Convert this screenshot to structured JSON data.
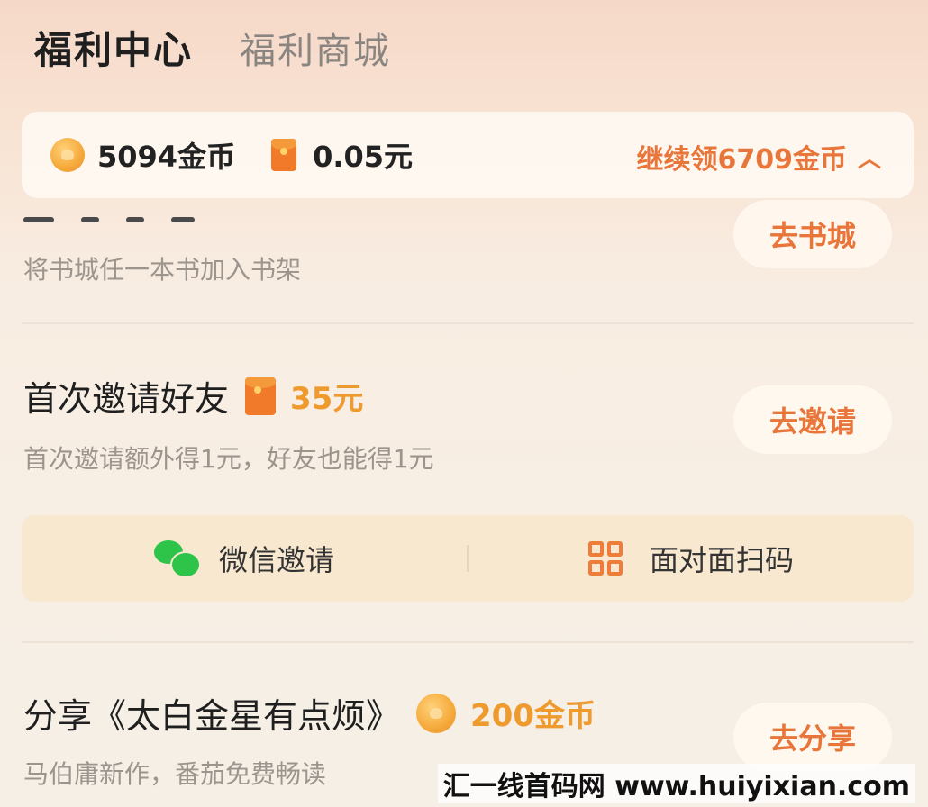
{
  "tabs": {
    "active": "福利中心",
    "other": "福利商城"
  },
  "wallet": {
    "coins": "5094金币",
    "cash": "0.05元",
    "more": "继续领6709金币",
    "more_icon": "chevron-up-icon"
  },
  "tasks": [
    {
      "title": "",
      "desc": "将书城任一本书加入书架",
      "button": "去书城"
    },
    {
      "title": "首次邀请好友",
      "reward": "35元",
      "reward_icon": "red-packet-icon",
      "desc": "首次邀请额外得1元，好友也能得1元",
      "button": "去邀请"
    },
    {
      "title": "分享《太白金星有点烦》",
      "reward": "200金币",
      "reward_icon": "coin-icon",
      "desc": "马伯庸新作，番茄免费畅读",
      "button": "去分享"
    }
  ],
  "invite_options": [
    {
      "label": "微信邀请",
      "icon": "wechat-icon"
    },
    {
      "label": "面对面扫码",
      "icon": "qr-code-icon"
    }
  ],
  "watermark": "汇一线首码网 www.huiyixian.com",
  "colors": {
    "accent": "#e8763a",
    "reward": "#ef9a2e",
    "wechat": "#2ec44a"
  }
}
